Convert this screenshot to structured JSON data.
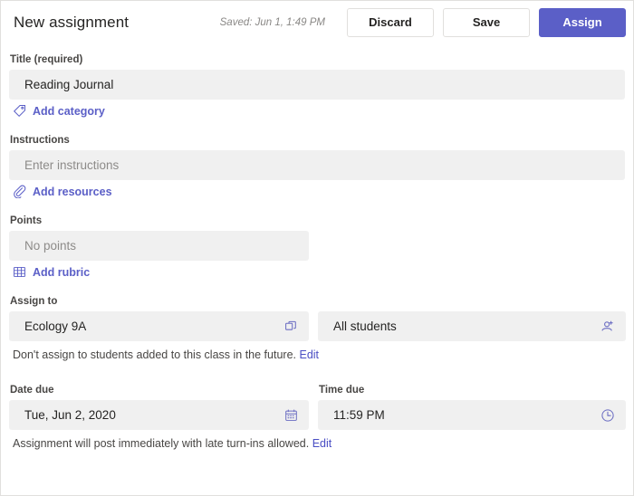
{
  "header": {
    "title": "New assignment",
    "saved_status": "Saved: Jun 1, 1:49 PM",
    "discard_label": "Discard",
    "save_label": "Save",
    "assign_label": "Assign",
    "accent_color": "#5b5fc7"
  },
  "form": {
    "title_field": {
      "label": "Title (required)",
      "value": "Reading Journal"
    },
    "add_category": {
      "label": "Add category",
      "icon": "tag-icon"
    },
    "instructions_field": {
      "label": "Instructions",
      "placeholder": "Enter instructions"
    },
    "add_resources": {
      "label": "Add resources",
      "icon": "paperclip-icon"
    },
    "points_field": {
      "label": "Points",
      "placeholder": "No points"
    },
    "add_rubric": {
      "label": "Add rubric",
      "icon": "grid-icon"
    },
    "assign_to": {
      "label": "Assign to",
      "class_value": "Ecology 9A",
      "class_icon": "duplicate-icon",
      "students_value": "All students",
      "students_icon": "person-add-icon",
      "helper_text": "Don't assign to students added to this class in the future.",
      "helper_link": "Edit"
    },
    "date_due": {
      "label": "Date due",
      "value": "Tue, Jun 2, 2020",
      "icon": "calendar-icon"
    },
    "time_due": {
      "label": "Time due",
      "value": "11:59 PM",
      "icon": "clock-icon"
    },
    "post_notice": {
      "text": "Assignment will post immediately with late turn-ins allowed.",
      "link": "Edit"
    }
  }
}
